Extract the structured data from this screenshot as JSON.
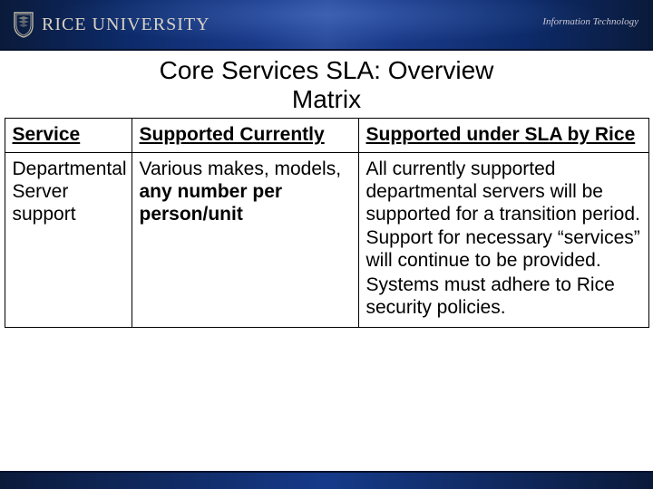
{
  "banner": {
    "university": "RICE UNIVERSITY",
    "dept": "Information Technology"
  },
  "title_line1": "Core Services SLA: Overview",
  "title_line2": "Matrix",
  "table": {
    "headers": {
      "h1": "Service",
      "h2": "Supported Currently",
      "h3": "Supported under SLA by Rice"
    },
    "row": {
      "service": "Departmental Server support",
      "currently_prefix": "Various makes, models, ",
      "currently_bold": "any number per person/unit",
      "sla_p1": "All currently supported departmental servers will be supported for a transition period.",
      "sla_p2": "Support for necessary “services” will continue to be provided.",
      "sla_p3": "Systems must adhere to Rice security policies."
    }
  }
}
